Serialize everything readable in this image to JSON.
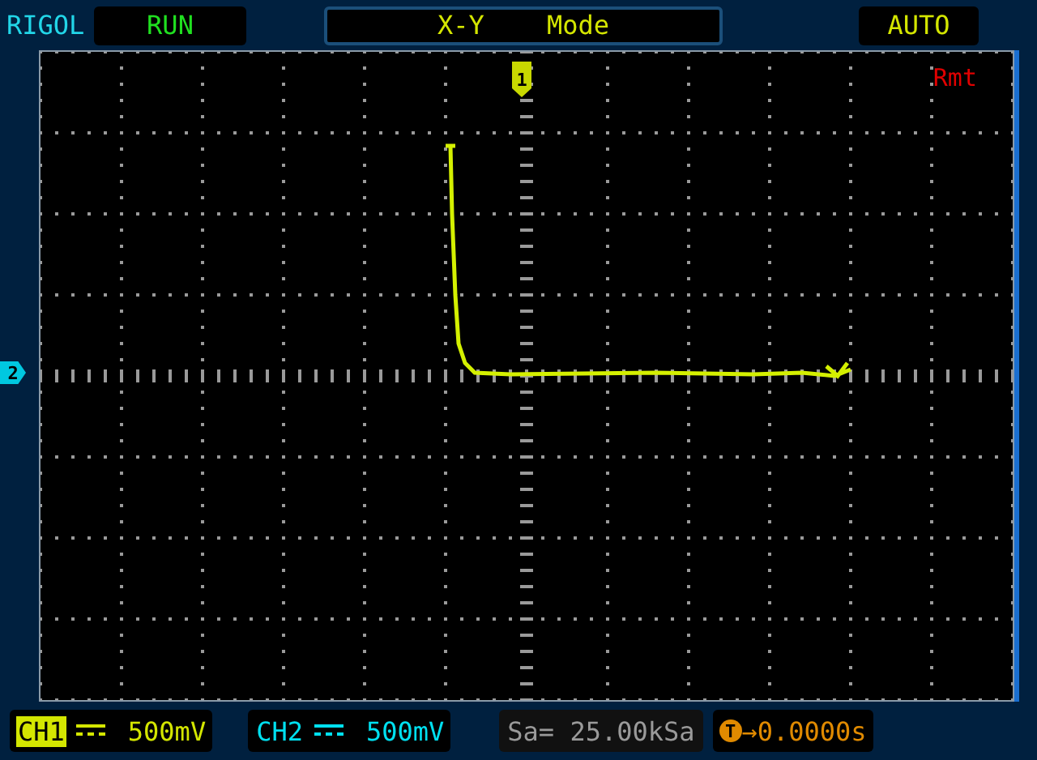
{
  "header": {
    "brand": "RIGOL",
    "run_status": "RUN",
    "mode_title": "X-Y    Mode",
    "trigger_mode": "AUTO"
  },
  "screen": {
    "remote_indicator": "Rmt",
    "ch1_marker": "1",
    "ch2_marker": "2"
  },
  "channels": [
    {
      "label": "CH1",
      "scale": "500mV",
      "selected": true,
      "color": "#d4e600"
    },
    {
      "label": "CH2",
      "scale": "500mV",
      "selected": false,
      "color": "#00e0f0"
    }
  ],
  "sample_rate": "Sa= 25.00kSa",
  "trigger": {
    "badge": "T",
    "offset": "→0.0000s"
  }
}
